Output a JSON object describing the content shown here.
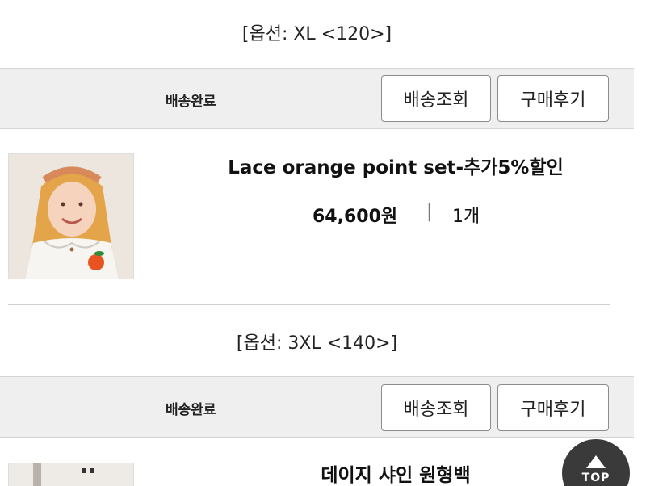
{
  "orders": [
    {
      "option": "[옵션: XL <120>]",
      "status": "배송완료",
      "track_button": "배송조회",
      "review_button": "구매후기"
    }
  ],
  "product1": {
    "name": "Lace orange point set-추가5%할인",
    "price": "64,600원",
    "separator": "|",
    "quantity": "1개",
    "option": "[옵션: 3XL <140>]",
    "status": "배송완료",
    "track_button": "배송조회",
    "review_button": "구매후기"
  },
  "product2": {
    "name": "데이지 샤인 원형백"
  },
  "top_button": {
    "label": "TOP"
  }
}
